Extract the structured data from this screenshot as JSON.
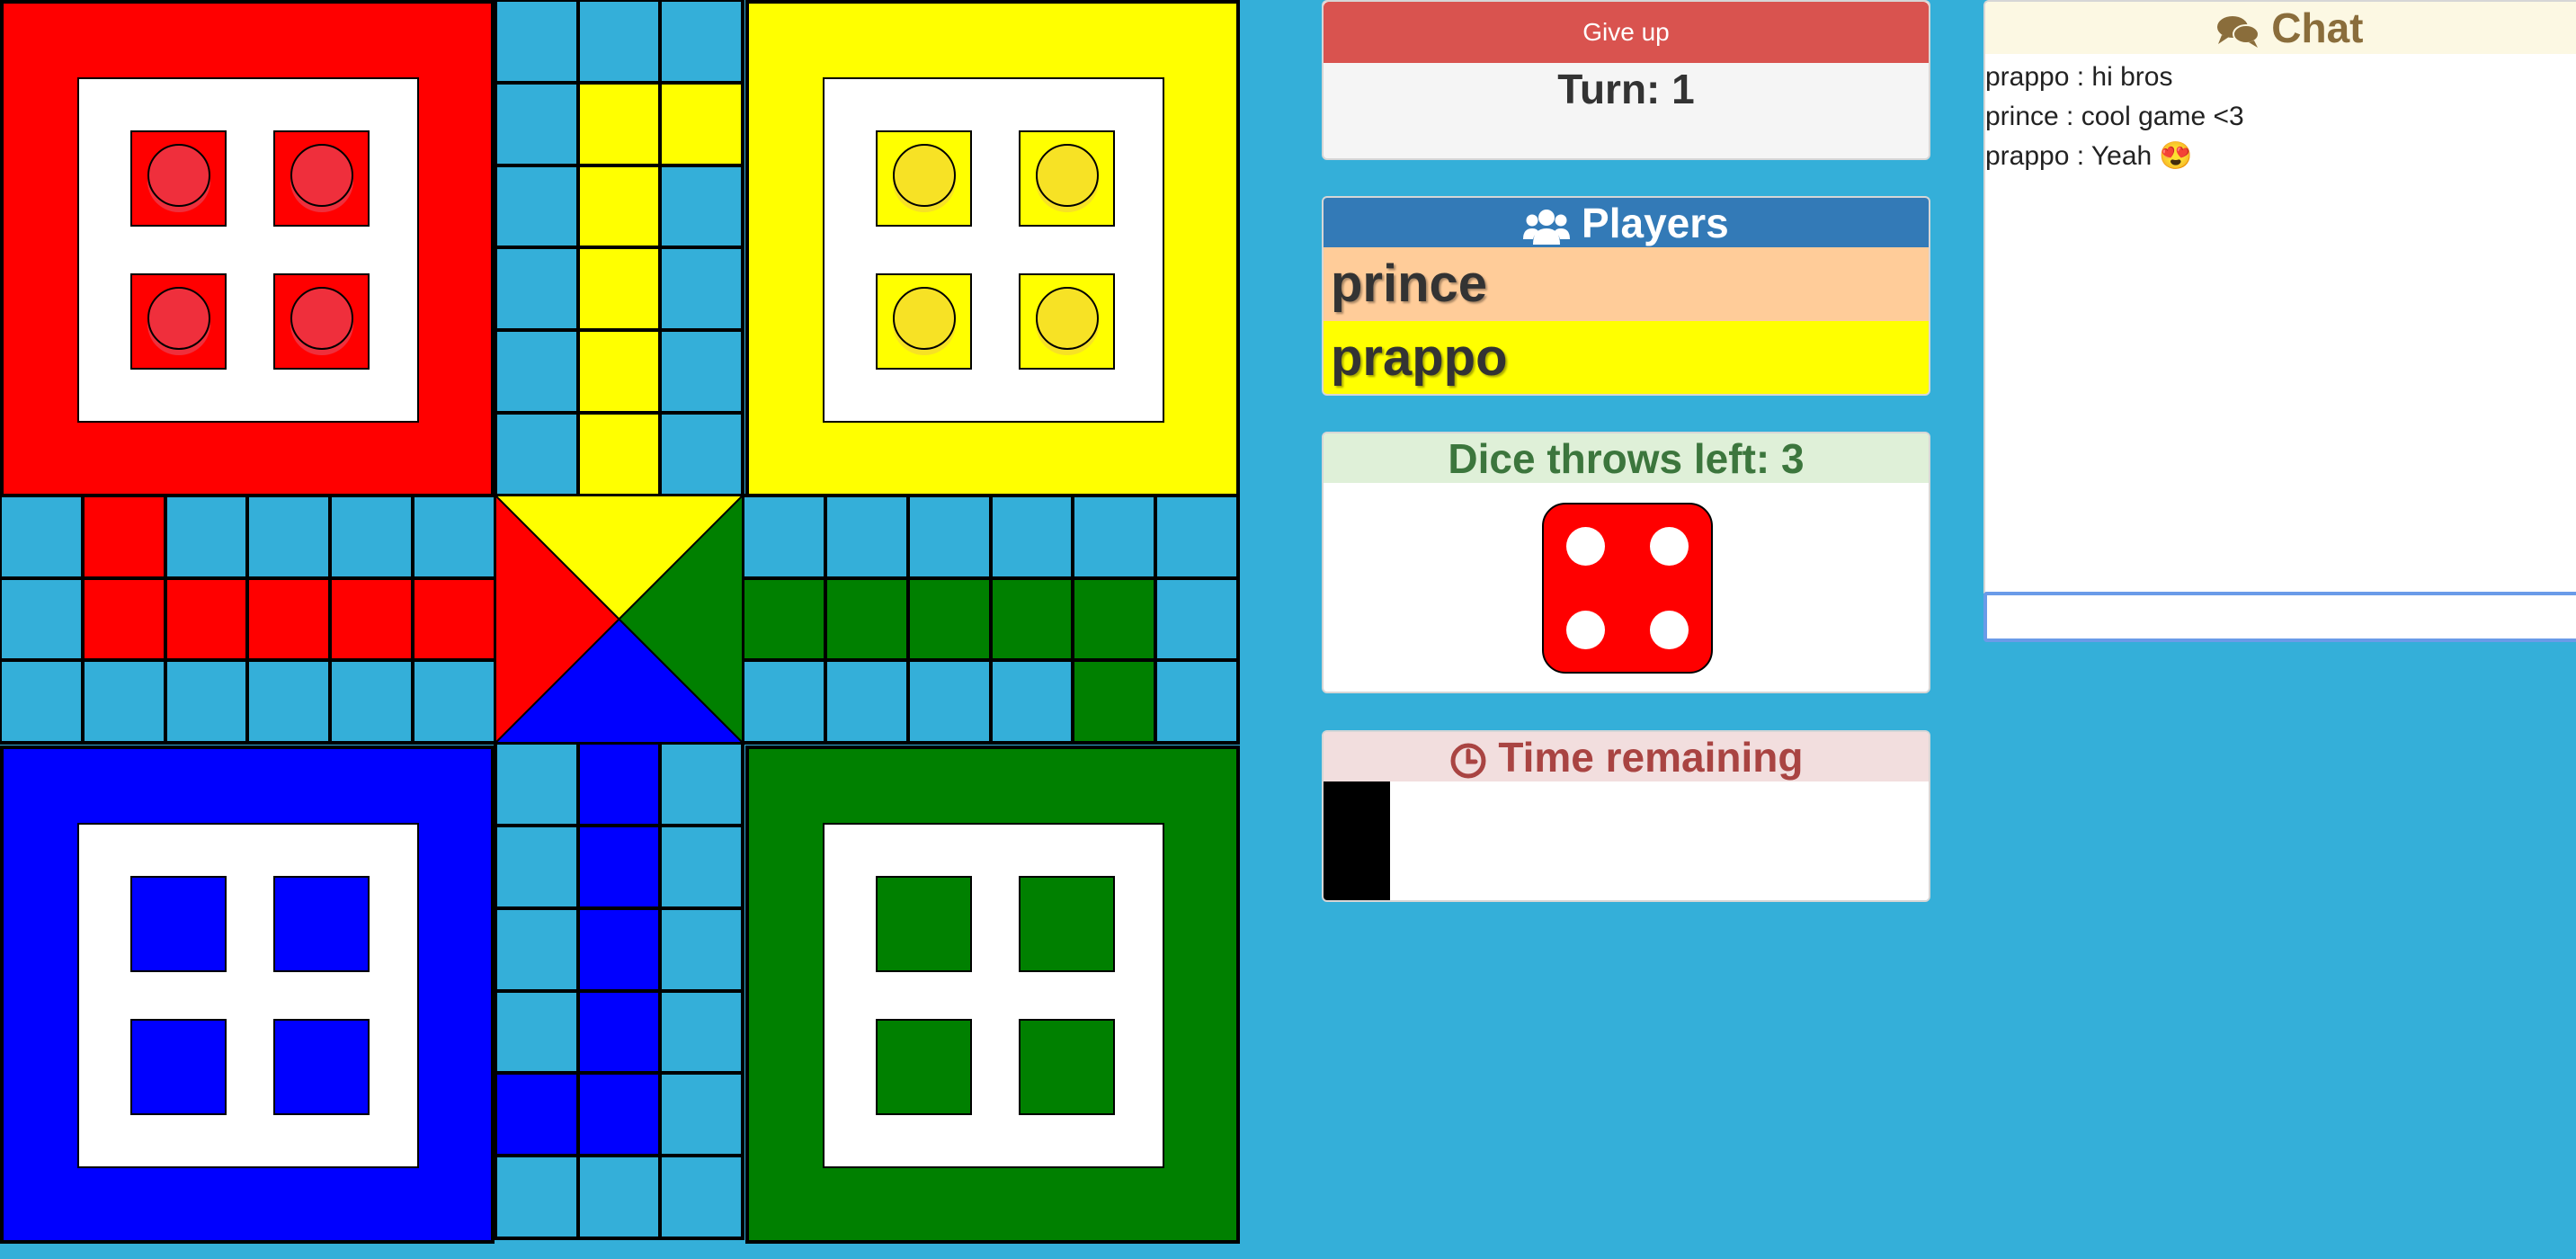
{
  "colors": {
    "red": "#ff0000",
    "yellow": "#ffff00",
    "blue": "#0000ff",
    "green": "#008000",
    "track": "#34afd9",
    "token_red": "#ef2f3c",
    "token_yellow": "#f7e225"
  },
  "board": {
    "homes": [
      {
        "color": "red",
        "tokens_in_base": 4
      },
      {
        "color": "yellow",
        "tokens_in_base": 4
      },
      {
        "color": "blue",
        "tokens_in_base": 0
      },
      {
        "color": "green",
        "tokens_in_base": 0
      }
    ]
  },
  "controls": {
    "give_up_label": "Give up",
    "turn_text": "Turn: 1"
  },
  "players": {
    "title": "Players",
    "icon": "users-icon",
    "list": [
      {
        "name": "prince",
        "color": "#ffcc99"
      },
      {
        "name": "prappo",
        "color": "#ffff00"
      }
    ]
  },
  "dice": {
    "title": "Dice throws left: 3",
    "value": 4,
    "color": "#ff0000"
  },
  "timer": {
    "title": "Time remaining",
    "icon": "clock-icon",
    "remaining_fraction": 0.11
  },
  "chat": {
    "title": "Chat",
    "icon": "comments-icon",
    "messages": [
      {
        "text": "prappo : hi bros"
      },
      {
        "text": "prince : cool game <3"
      },
      {
        "text": "prappo : Yeah",
        "emoji": "😍"
      }
    ],
    "input_value": ""
  }
}
